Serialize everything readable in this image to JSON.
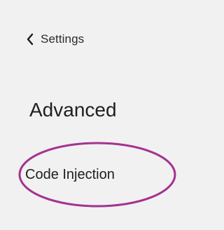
{
  "nav": {
    "back_label": "Settings",
    "back_icon": "chevron-left-icon"
  },
  "section": {
    "title": "Advanced"
  },
  "menu": {
    "items": [
      {
        "label": "Code Injection",
        "highlighted": true
      }
    ]
  },
  "colors": {
    "background": "#f1f1f1",
    "highlight_ring": "#a4338f",
    "text": "#1e1e1e"
  }
}
